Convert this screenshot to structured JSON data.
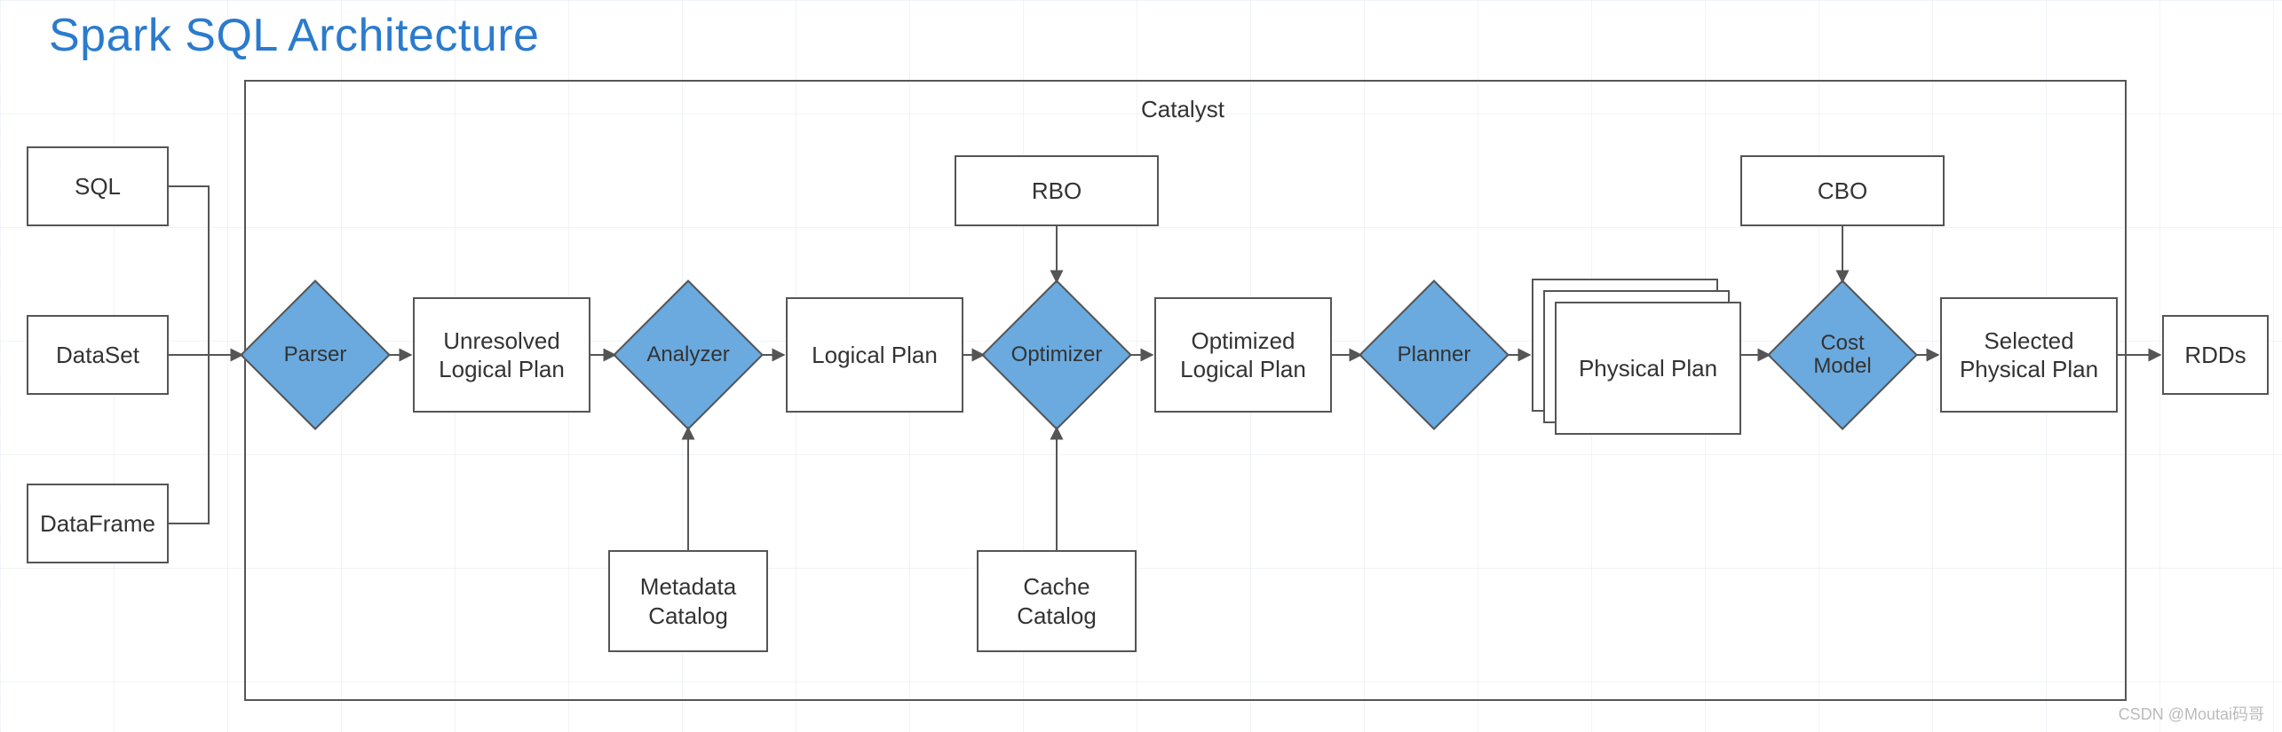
{
  "title": "Spark SQL Architecture",
  "frame_label": "Catalyst",
  "inputs": {
    "sql": "SQL",
    "dataset": "DataSet",
    "dataframe": "DataFrame"
  },
  "stages": {
    "parser": "Parser",
    "unresolved": "Unresolved Logical Plan",
    "analyzer": "Analyzer",
    "logical_plan": "Logical Plan",
    "optimizer": "Optimizer",
    "optimized": "Optimized Logical Plan",
    "planner": "Planner",
    "physical_plan": "Physical Plan",
    "cost_model": "Cost Model",
    "selected": "Selected Physical Plan"
  },
  "aux": {
    "rbo": "RBO",
    "cbo": "CBO",
    "metadata_catalog": "Metadata Catalog",
    "cache_catalog": "Cache Catalog"
  },
  "output": "RDDs",
  "watermark": "CSDN @Moutai码哥",
  "colors": {
    "accent": "#6aaadf",
    "title": "#2b7bcd",
    "stroke": "#555"
  }
}
